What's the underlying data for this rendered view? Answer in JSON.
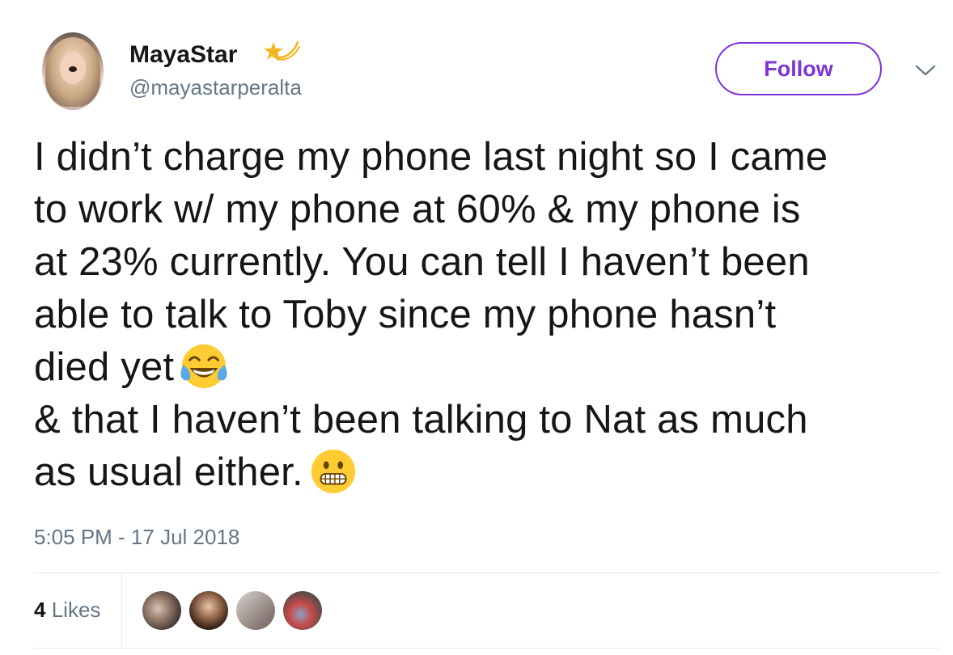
{
  "user": {
    "display_name": "MayaStar",
    "handle": "@mayastarperalta",
    "name_icon": "shooting-star-icon"
  },
  "actions": {
    "follow_label": "Follow",
    "menu_icon": "chevron-down-icon"
  },
  "tweet": {
    "lines": [
      "I didn’t charge my phone last night so I came",
      "to work w/ my phone at 60% & my phone is",
      "at 23% currently. You can tell I haven’t been",
      "able to talk to Toby since my phone hasn’t",
      "died yet",
      "& that I haven’t been talking to Nat as much",
      "as usual either."
    ],
    "emojis": [
      "face-with-tears-of-joy",
      "grimacing-face"
    ],
    "timestamp": "5:05 PM - 17 Jul 2018"
  },
  "stats": {
    "likes_count": "4",
    "likes_label": "Likes",
    "liker_avatar_count": 4
  },
  "colors": {
    "accent": "#7d33d6",
    "text": "#14171a",
    "secondary": "#657786",
    "divider": "#e1e8ed"
  }
}
